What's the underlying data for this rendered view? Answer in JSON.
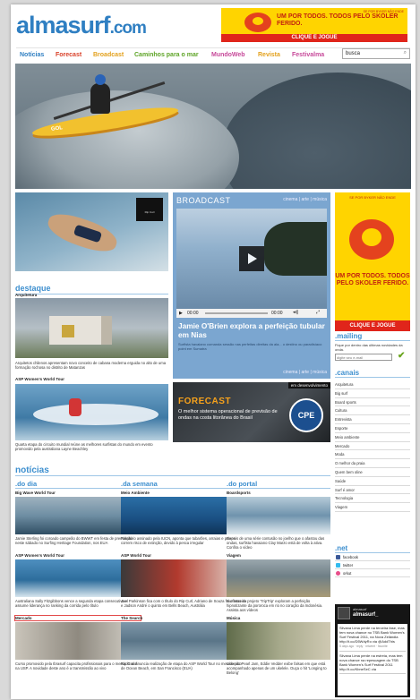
{
  "brand": {
    "name": "almasurf",
    "suffix": ".com"
  },
  "top_ad": {
    "tagline": "UM POR TODOS. TODOS PELO SKOLER FERIDO.",
    "button": "CLIQUE E JOGUE",
    "fine_print": "SE POR BYKER NÃO ENDE"
  },
  "nav": {
    "items": [
      "Notícias",
      "Forecast",
      "Broadcast",
      "Caminhos para o mar",
      "MundoWeb",
      "Revista",
      "Festivalma"
    ],
    "search_value": "busca"
  },
  "hero": {
    "logo_text": "GOL"
  },
  "promo": {
    "brand_text": "Rip Curl"
  },
  "broadcast": {
    "heading": "BROADCAST",
    "links": [
      "cinema",
      "arte",
      "música"
    ],
    "time_start": "00:00",
    "time_end": "00:00",
    "title": "Jamie O'Brien explora a perfeição tubular em Nias",
    "desc": "Surfista havaiano comanda sessão nas perfeitas direitas da ala... o destino ou paradisíaco point em Sumatra"
  },
  "side_ad": {
    "top": "SE POR BYKER NÃO ENDE",
    "slogan": "UM POR TODOS. TODOS PELO SKOLER FERIDO.",
    "button": "CLIQUE E JOGUE"
  },
  "destaque": {
    "heading": "destaque",
    "items": [
      {
        "category": "Arquitetura",
        "caption": "Arquitetos chilenos apresentam novo conceito de cabana moderna erguida no alto de uma formação rochosa no distrito de Matanzas"
      },
      {
        "category": "ASP Women's World Tour",
        "caption": "Quarta etapa do circuito mundial reúne as melhores surfistas do mundo em evento promovido pela australiana Layne Beachley"
      }
    ]
  },
  "forecast": {
    "badge": "em desenvolvimento",
    "title": "FORECAST",
    "desc": "O melhor sistema operacional de previsão de ondas na costa litorânea do Brasil",
    "seal": "CPE"
  },
  "mailing": {
    "title": ".mailing",
    "desc": "Fique por dentro das últimas novidades da onda.",
    "placeholder": "digite seu e-mail"
  },
  "canais": {
    "title": ".canais",
    "items": [
      "Arquitetura",
      "Big surf",
      "Board sports",
      "Cultura",
      "Entrevista",
      "Esporte",
      "Meio ambiente",
      "Mercado",
      "Moda",
      "O melhor da praia",
      "Quem bem oline",
      "Saúde",
      "Surf é amor",
      "Tecnologia",
      "Viagem"
    ]
  },
  "noticias": {
    "heading": "notícias",
    "columns": [
      {
        "title": ".do dia",
        "items": [
          {
            "category": "Big Wave World Tour",
            "caption": "Jamie Sterling foi coroado campeão do BWWT em festa de premiação neste sábado no Surfing Heritage Foundation, nos EUA"
          },
          {
            "category": "ASP Women's World Tour",
            "caption": "Australiana Sally Fitzgibbons vence a segunda etapa consecutiva e assume liderança no ranking da corrida pelo título"
          },
          {
            "category": "Mercado",
            "caption": "Curso promovido pela Ibrasurf capacita profissionais para o mercado surf na USP. A novidade deste ano é a transmissão ao vivo"
          }
        ]
      },
      {
        "title": ".da semana",
        "items": [
          {
            "category": "Meio Ambiente",
            "caption": "Relatório assinado pela IUCN, aponta que tubarões, arraias e peixes correm risco de extinção, devido à pesca irregular"
          },
          {
            "category": "ASP World Tour",
            "caption": "Joel Parkinson fica com o título do Rip Curl, Adriano de Souza foi o terceiro e Jadson André o quinto em Bells Beach, Austrália"
          },
          {
            "category": "The Search",
            "caption": "Rip Curl anuncia realização de etapa do ASP World Tour no mesmo pico de Ocean Beach, em San Francisco (EUA)"
          }
        ]
      },
      {
        "title": ".do portal",
        "items": [
          {
            "category": "Boardsports",
            "caption": "Depois de uma série contusão no joelho que o afastou das ondas, surfista havaiano Clay Marzo está de volta à ativa. Confira o vídeo"
          },
          {
            "category": "Viagem",
            "caption": "Surfistas do projeto 'TripTrip' exploram a perfeição hipnotizante da pororoca em rio no coração da Indonésia. Assista aos vídeos"
          },
          {
            "category": "Música",
            "caption": "Líder do Pearl Jam, Eddie Vedder exibe falsas em que está acompanhado apenas de um ukelele. Ouça o hit 'Longing to Belong'"
          }
        ]
      }
    ]
  },
  "net": {
    "title": ".net",
    "items": [
      "facebook",
      "twitter",
      "orkut"
    ]
  },
  "twitter_widget": {
    "label": "almasurf",
    "handle": "almasurf_",
    "tweets": [
      "Silvana Lima perde na terceira fase, mas tem nova chance no TSB Bank Women's Surf Festival 2011, na Nova Zelândia http://t.co/D5WdyRo via @AddThis",
      "Silvana Lima perde na estreia, mas tem nova chance na repescagem do TSB Bank Women's Surf Festival 2011 http://t.co/KbneSeC via"
    ],
    "meta": "5 days ago · reply · retweet · favorite"
  },
  "colors": {
    "accent": "#3d8fcf",
    "brand": "#2f7fc2",
    "ad_yellow": "#ffd400",
    "ad_red": "#e0251b"
  }
}
